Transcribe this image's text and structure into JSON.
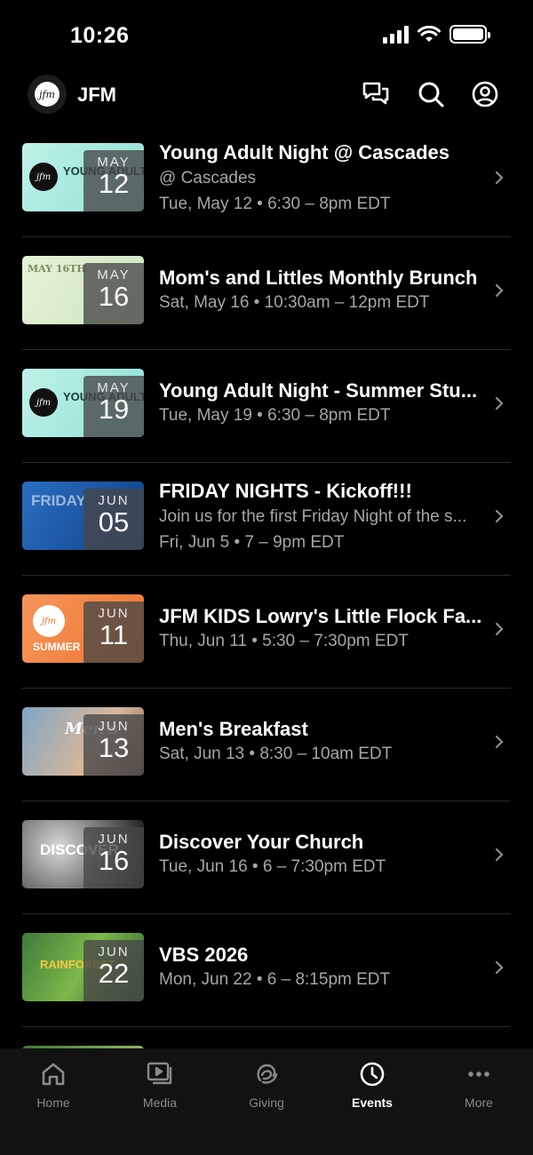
{
  "status_bar": {
    "time": "10:26",
    "battery_level": 1.0
  },
  "header": {
    "logo_text": "jfm",
    "title": "JFM"
  },
  "events": [
    {
      "title": "Young Adult Night @ Cascades",
      "line1": "@ Cascades",
      "line2": "Tue, May 12 • 6:30 – 8pm EDT",
      "month": "MAY",
      "day": "12",
      "thumb_text": "YOUNG ADULTS"
    },
    {
      "title": "Mom's and Littles Monthly Brunch",
      "line1": "Sat, May 16 • 10:30am – 12pm EDT",
      "line2": "",
      "month": "MAY",
      "day": "16",
      "thumb_text": "MAY 16TH"
    },
    {
      "title": "Young Adult Night - Summer Stu...",
      "line1": "Tue, May 19 • 6:30 – 8pm EDT",
      "line2": "",
      "month": "MAY",
      "day": "19",
      "thumb_text": "YOUNG ADULTS"
    },
    {
      "title": "FRIDAY NIGHTS - Kickoff!!!",
      "line1": "Join us for the first Friday Night of the s...",
      "line2": "Fri, Jun 5 • 7 – 9pm EDT",
      "month": "JUN",
      "day": "05",
      "thumb_text": "FRIDAY"
    },
    {
      "title": "JFM KIDS Lowry's Little Flock Fa...",
      "line1": "Thu, Jun 11 • 5:30 – 7:30pm EDT",
      "line2": "",
      "month": "JUN",
      "day": "11",
      "thumb_text": "SUMMER"
    },
    {
      "title": "Men's Breakfast",
      "line1": "Sat, Jun 13 • 8:30 – 10am EDT",
      "line2": "",
      "month": "JUN",
      "day": "13",
      "thumb_text": "Men's"
    },
    {
      "title": "Discover Your Church",
      "line1": "Tue, Jun 16 • 6 – 7:30pm EDT",
      "line2": "",
      "month": "JUN",
      "day": "16",
      "thumb_text": "DISCOVER"
    },
    {
      "title": "VBS 2026",
      "line1": "Mon, Jun 22 • 6 – 8:15pm EDT",
      "line2": "",
      "month": "JUN",
      "day": "22",
      "thumb_text": "RAINFOREST"
    }
  ],
  "tabs": [
    {
      "label": "Home",
      "icon": "home-icon"
    },
    {
      "label": "Media",
      "icon": "media-icon"
    },
    {
      "label": "Giving",
      "icon": "giving-icon"
    },
    {
      "label": "Events",
      "icon": "clock-icon"
    },
    {
      "label": "More",
      "icon": "more-icon"
    }
  ],
  "colors": {
    "background": "#000000",
    "tab_bar": "#121212",
    "muted_text": "#a6a6a6",
    "active_tab": "#ffffff",
    "inactive_tab": "#8a8a8a"
  }
}
